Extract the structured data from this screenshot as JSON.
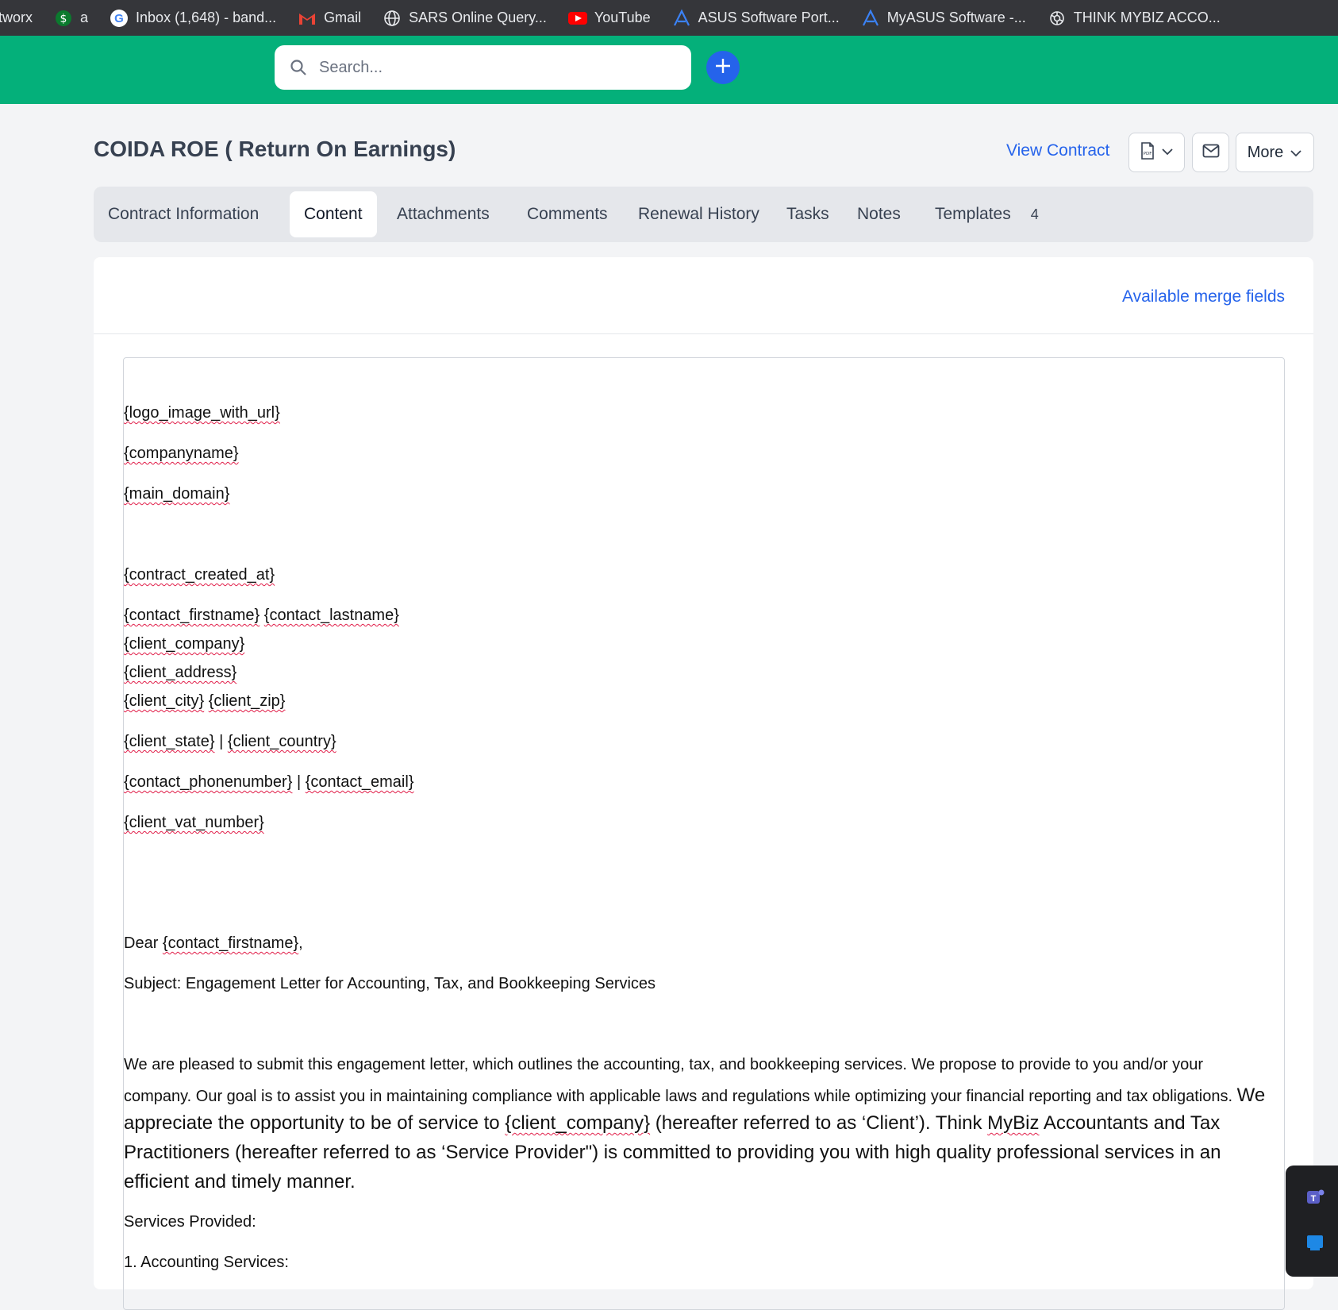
{
  "bookmarks": [
    {
      "label": "tworx",
      "icon": "none"
    },
    {
      "label": "a",
      "icon": "dollar-globe-icon"
    },
    {
      "label": "Inbox (1,648) - band...",
      "icon": "google-icon"
    },
    {
      "label": "Gmail",
      "icon": "gmail-icon"
    },
    {
      "label": "SARS Online Query...",
      "icon": "globe-icon"
    },
    {
      "label": "YouTube",
      "icon": "youtube-icon"
    },
    {
      "label": "ASUS Software Port...",
      "icon": "asus-icon"
    },
    {
      "label": "MyASUS Software -...",
      "icon": "asus-icon"
    },
    {
      "label": "THINK MYBIZ ACCO...",
      "icon": "openai-icon"
    }
  ],
  "header": {
    "search_placeholder": "Search...",
    "brand_color": "#04b07a",
    "accent_color": "#2563eb"
  },
  "page": {
    "title": "COIDA ROE ( Return On Earnings)"
  },
  "actions": {
    "view_contract": "View Contract",
    "more": "More"
  },
  "tabs": [
    {
      "label": "Contract Information"
    },
    {
      "label": "Content",
      "active": true
    },
    {
      "label": "Attachments"
    },
    {
      "label": "Comments"
    },
    {
      "label": "Renewal History"
    },
    {
      "label": "Tasks"
    },
    {
      "label": "Notes"
    },
    {
      "label": "Templates",
      "count": "4"
    }
  ],
  "content": {
    "merge_fields_link": "Available merge fields",
    "lines": {
      "logo": "{logo_image_with_url}",
      "companyname": "{companyname}",
      "main_domain": "{main_domain}",
      "created_at": "{contract_created_at}",
      "contact_first": "{contact_firstname}",
      "contact_last": "{contact_lastname}",
      "client_company": "{client_company}",
      "client_address": "{client_address}",
      "client_city": "{client_city}",
      "client_zip": "{client_zip}",
      "client_state": "{client_state}",
      "sep": "|",
      "client_country": "{client_country}",
      "contact_phone": "{contact_phonenumber}",
      "contact_email": "{contact_email}",
      "client_vat": "{client_vat_number}",
      "dear": "Dear",
      "dear_field": "{contact_firstname}",
      "comma": ",",
      "subject": "Subject: Engagement Letter for Accounting, Tax, and Bookkeeping Services",
      "p1": "We are pleased to submit this engagement letter, which outlines the accounting, tax, and bookkeeping services. We propose to provide to you and/or your",
      "p2a": "company. Our goal is to assist you in maintaining compliance with applicable laws and regulations while optimizing your financial reporting and tax obligations.",
      "p2b": "We",
      "p3a": "appreciate the opportunity to be of service to",
      "p3b": "{client_company}",
      "p3c": "(hereafter referred to as ‘Client’).  Think",
      "p3d": "MyBiz",
      "p3e": "Accountants and Tax",
      "p4": "Practitioners (hereafter referred to as ‘Service Provider\") is committed to providing you with high quality professional services in an",
      "p5": "efficient and timely manner.",
      "services": "Services Provided:",
      "accounting": "1. Accounting Services:"
    }
  }
}
